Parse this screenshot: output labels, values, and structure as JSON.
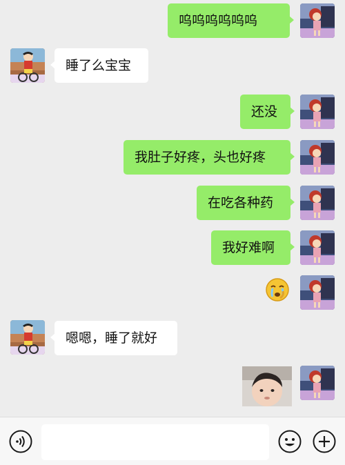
{
  "messages": [
    {
      "sender": "me",
      "type": "text",
      "text": "呜呜呜呜呜呜"
    },
    {
      "sender": "other",
      "type": "text",
      "text": "睡了么宝宝"
    },
    {
      "sender": "me",
      "type": "text",
      "text": "还没"
    },
    {
      "sender": "me",
      "type": "text",
      "text": "我肚子好疼，头也好疼"
    },
    {
      "sender": "me",
      "type": "text",
      "text": "在吃各种药"
    },
    {
      "sender": "me",
      "type": "text",
      "text": "我好难啊"
    },
    {
      "sender": "me",
      "type": "sticker",
      "icon": "crying-emoji-icon"
    },
    {
      "sender": "other",
      "type": "text",
      "text": "嗯嗯，睡了就好"
    },
    {
      "sender": "me",
      "type": "image",
      "icon": "baby-photo"
    }
  ],
  "input_bar": {
    "voice_icon": "voice-icon",
    "text_value": "",
    "emoji_icon": "emoji-icon",
    "plus_icon": "plus-icon"
  },
  "colors": {
    "background": "#ededed",
    "my_bubble": "#95ec69",
    "their_bubble": "#ffffff"
  }
}
